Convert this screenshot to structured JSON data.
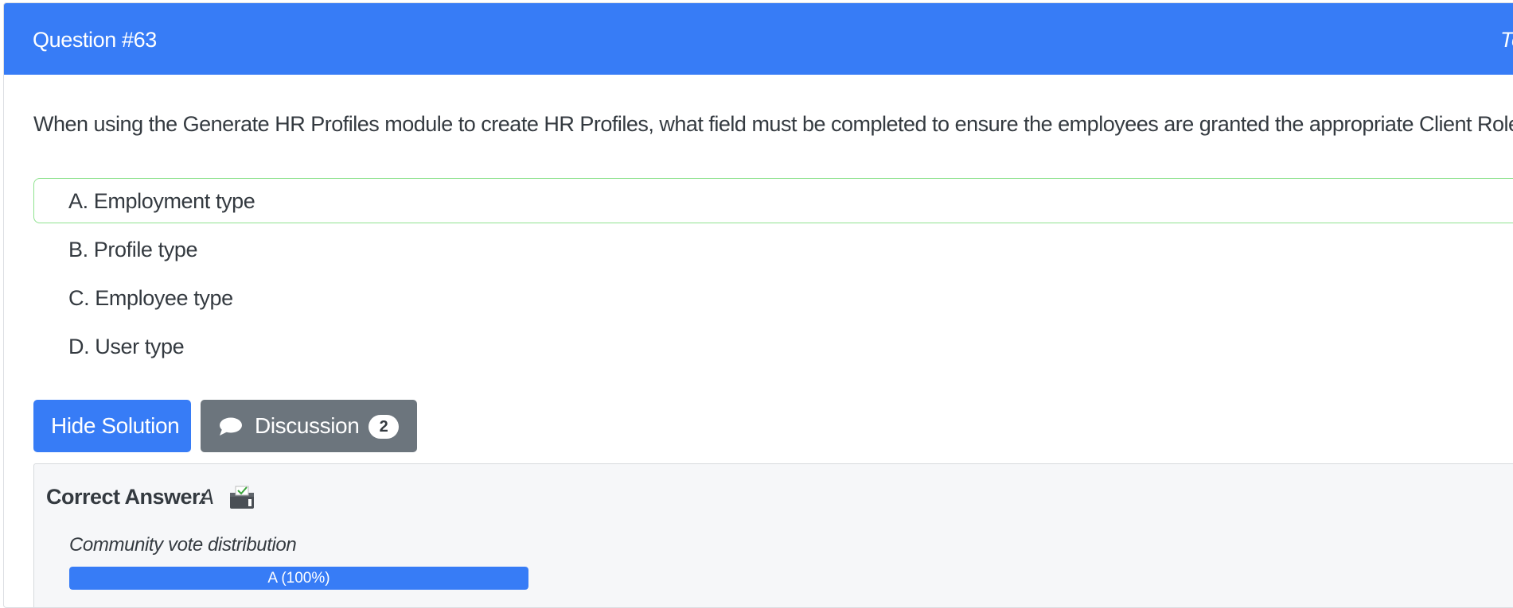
{
  "header": {
    "question_title": "Question #63",
    "topic_label": "To"
  },
  "question": {
    "text": "When using the Generate HR Profiles module to create HR Profiles, what field must be completed to ensure the employees are granted the appropriate Client Role?"
  },
  "choices": [
    {
      "label": "A. Employment type"
    },
    {
      "label": "B. Profile type"
    },
    {
      "label": "C. Employee type"
    },
    {
      "label": "D. User type"
    }
  ],
  "buttons": {
    "hide_solution": "Hide Solution",
    "discussion": "Discussion",
    "discussion_count": "2"
  },
  "answer": {
    "label": "Correct Answer:",
    "value": "A"
  },
  "vote": {
    "title": "Community vote distribution",
    "bar_label": "A (100%)",
    "fraction": 1.0
  },
  "icons": {
    "discussion": "chat-bubble-icon",
    "answer": "ballot-box-icon"
  },
  "colors": {
    "primary": "#377cf6",
    "secondary": "#6c757d",
    "highlight_border": "#8ee28e",
    "answer_background": "#f6f7f9"
  }
}
